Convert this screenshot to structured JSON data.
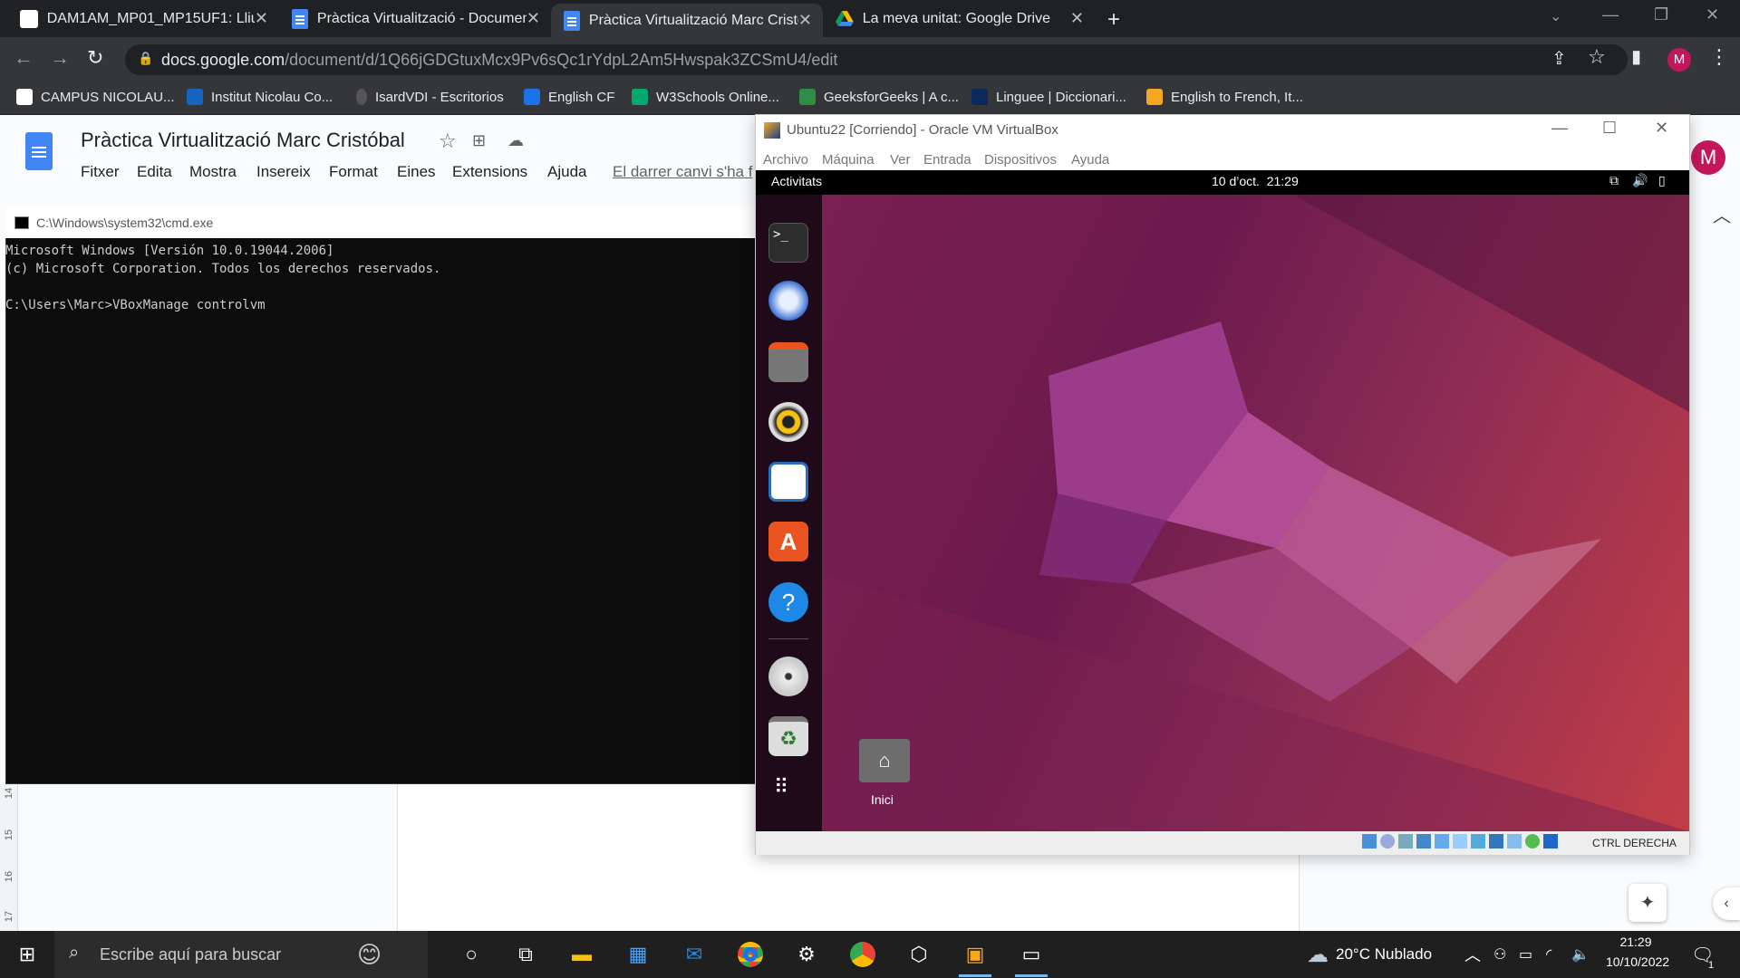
{
  "browser": {
    "tabs": [
      {
        "label": "DAM1AM_MP01_MP15UF1: Lliur"
      },
      {
        "label": "Pràctica Virtualització - Documen"
      },
      {
        "label": "Pràctica Virtualització Marc Cristò"
      },
      {
        "label": "La meva unitat: Google Drive"
      }
    ],
    "url_host": "docs.google.com",
    "url_path": "/document/d/1Q66jGDGtuxMcx9Pv6sQc1rYdpL2Am5Hwspak3ZCSmU4/edit",
    "profile_initial": "M",
    "bookmarks": [
      "CAMPUS NICOLAU...",
      "Institut Nicolau Co...",
      "IsardVDI - Escritorios",
      "English CF",
      "W3Schools Online...",
      "GeeksforGeeks | A c...",
      "Linguee | Diccionari...",
      "English to French, It..."
    ]
  },
  "docs": {
    "title": "Pràctica Virtualització Marc Cristóbal",
    "menu": [
      "Fitxer",
      "Edita",
      "Mostra",
      "Insereix",
      "Format",
      "Eines",
      "Extensions",
      "Ajuda"
    ],
    "last_edit": "El darrer canvi s'ha f",
    "ruler_numbers": [
      "14",
      "15",
      "16",
      "17"
    ]
  },
  "cmd": {
    "title": "C:\\Windows\\system32\\cmd.exe",
    "lines": [
      "Microsoft Windows [Versión 10.0.19044.2006]",
      "(c) Microsoft Corporation. Todos los derechos reservados.",
      "",
      "C:\\Users\\Marc>VBoxManage controlvm"
    ]
  },
  "virtualbox": {
    "title": "Ubuntu22 [Corriendo] - Oracle VM VirtualBox",
    "menu": [
      "Archivo",
      "Máquina",
      "Ver",
      "Entrada",
      "Dispositivos",
      "Ayuda"
    ],
    "host_key": "CTRL DERECHA"
  },
  "ubuntu": {
    "activities": "Activitats",
    "clock": "10 d’oct.  21:29",
    "home_label": "Inici"
  },
  "taskbar": {
    "search_placeholder": "Escribe aquí para buscar",
    "weather": "20°C  Nublado",
    "time": "21:29",
    "date": "10/10/2022"
  },
  "colors": {
    "chrome_dark": "#202124",
    "chrome_toolbar": "#35363a",
    "docs_blue": "#4285f4",
    "ubuntu_orange": "#e95420",
    "avatar": "#c2185b"
  }
}
